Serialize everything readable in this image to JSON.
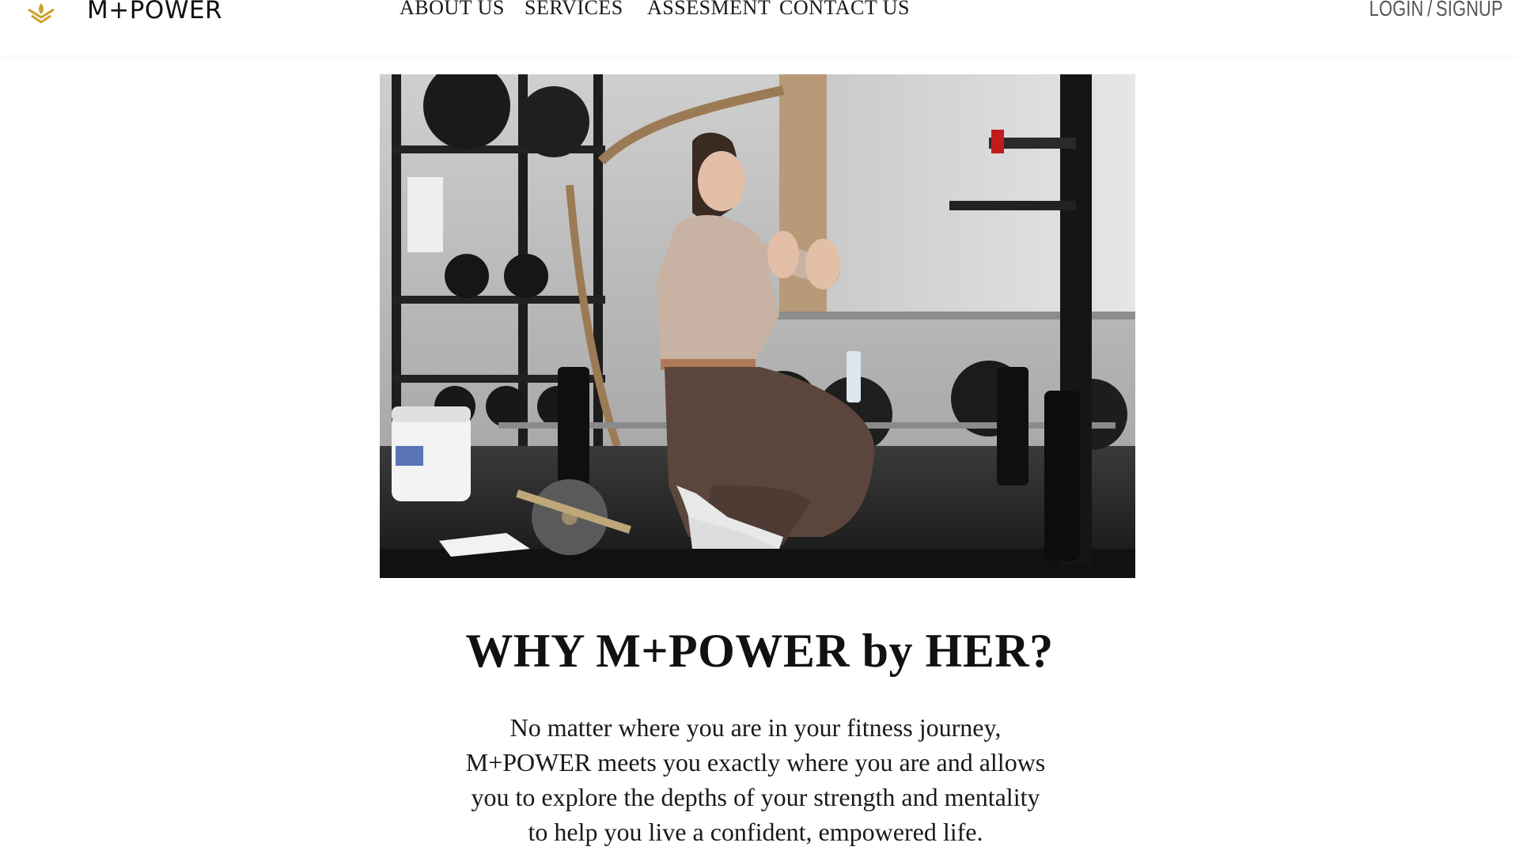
{
  "header": {
    "brand": "M+POWER",
    "logo_icon": "lotus-icon",
    "brand_color": "#C9A227",
    "nav": [
      {
        "label": "ABOUT US"
      },
      {
        "label": "SERVICES"
      },
      {
        "label": "ASSESMENT"
      },
      {
        "label": "CONTACT US"
      }
    ],
    "auth": {
      "login": "LOGIN",
      "separator": "/",
      "signup": "SIGNUP"
    }
  },
  "hero": {
    "image": "trainer-kneeling-clapping-in-gym-photo"
  },
  "main": {
    "headline": "WHY M+POWER by HER?",
    "body_lines": [
      "No matter where you are in your fitness journey,",
      "M+POWER meets you exactly where you are and allows",
      "you to explore the depths of your strength and mentality",
      "to help you live a confident, empowered life."
    ]
  }
}
